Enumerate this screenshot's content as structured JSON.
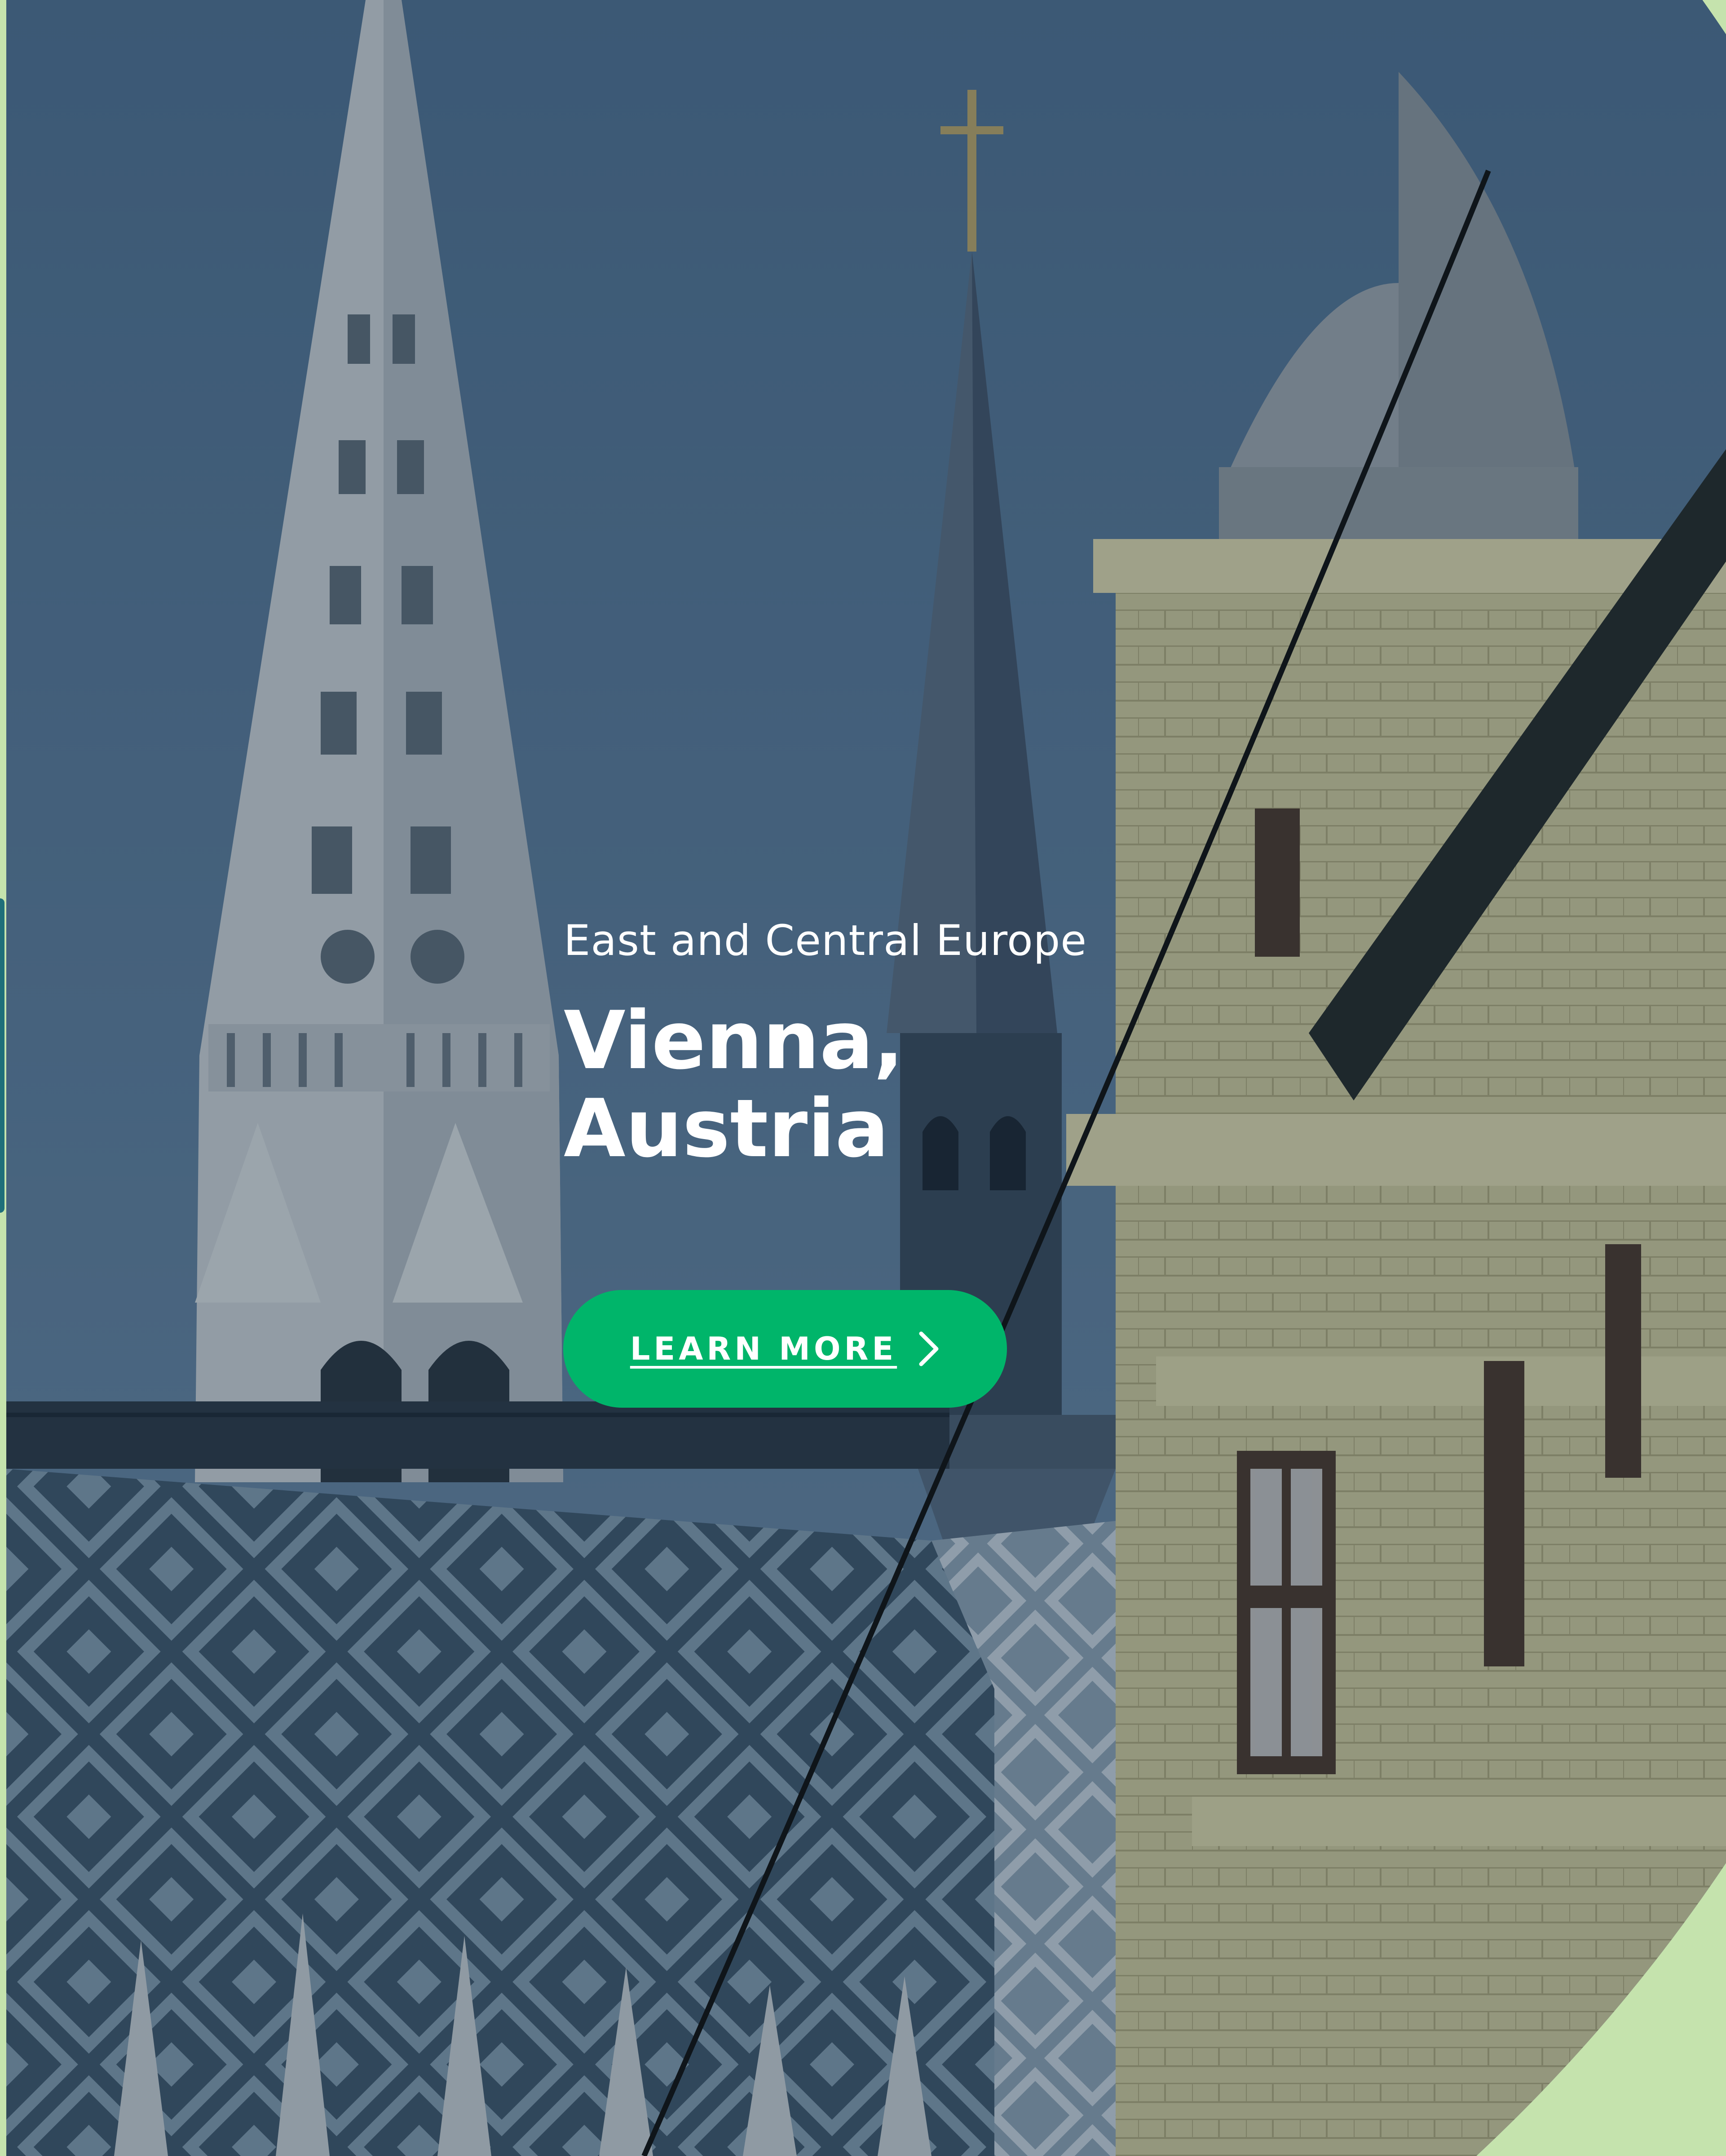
{
  "hero": {
    "region": "East and Central Europe",
    "title_line1": "Vienna,",
    "title_line2": "Austria",
    "cta_label": "LEARN MORE",
    "cta_icon": "chevron-right-icon"
  },
  "colors": {
    "background": "#c5e3ad",
    "accent": "#00b56a",
    "text": "#ffffff",
    "sky": "#5d7d9c"
  }
}
